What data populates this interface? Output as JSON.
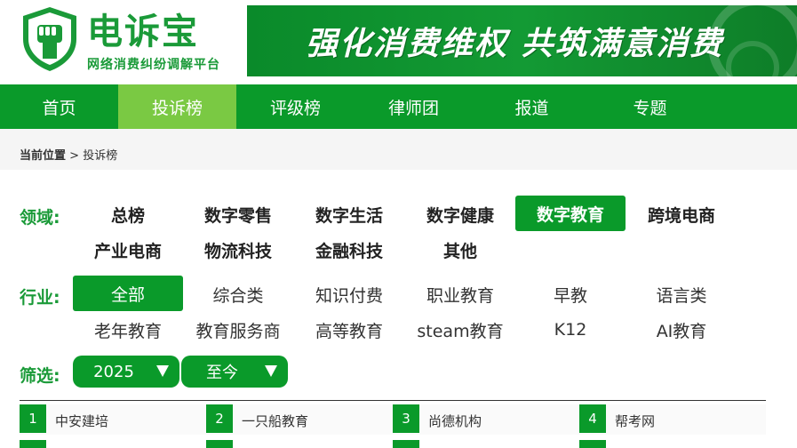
{
  "brand": {
    "name": "电诉宝",
    "subtitle": "网络消费纠纷调解平台",
    "color": "#1a9a38"
  },
  "banner": {
    "slogan": "强化消费维权  共筑满意消费"
  },
  "nav": {
    "items": [
      {
        "label": "首页",
        "active": false
      },
      {
        "label": "投诉榜",
        "active": true
      },
      {
        "label": "评级榜",
        "active": false
      },
      {
        "label": "律师团",
        "active": false
      },
      {
        "label": "报道",
        "active": false
      },
      {
        "label": "专题",
        "active": false
      }
    ],
    "bg_color": "#0a9a2a",
    "active_color": "#7ac943"
  },
  "breadcrumb": {
    "prefix": "当前位置",
    "separator": ">",
    "current": "投诉榜"
  },
  "filters": {
    "domain": {
      "label": "领域:",
      "options": [
        "总榜",
        "数字零售",
        "数字生活",
        "数字健康",
        "数字教育",
        "跨境电商",
        "产业电商",
        "物流科技",
        "金融科技",
        "其他"
      ],
      "selected": "数字教育"
    },
    "industry": {
      "label": "行业:",
      "options": [
        "全部",
        "综合类",
        "知识付费",
        "职业教育",
        "早教",
        "语言类",
        "老年教育",
        "教育服务商",
        "高等教育",
        "steam教育",
        "K12",
        "AI教育"
      ],
      "selected": "全部"
    },
    "screen": {
      "label": "筛选:",
      "year": "2025",
      "range": "至今"
    }
  },
  "ranking": [
    {
      "rank": "1",
      "name": "中安建培"
    },
    {
      "rank": "2",
      "name": "一只船教育"
    },
    {
      "rank": "3",
      "name": "尚德机构"
    },
    {
      "rank": "4",
      "name": "帮考网"
    }
  ]
}
